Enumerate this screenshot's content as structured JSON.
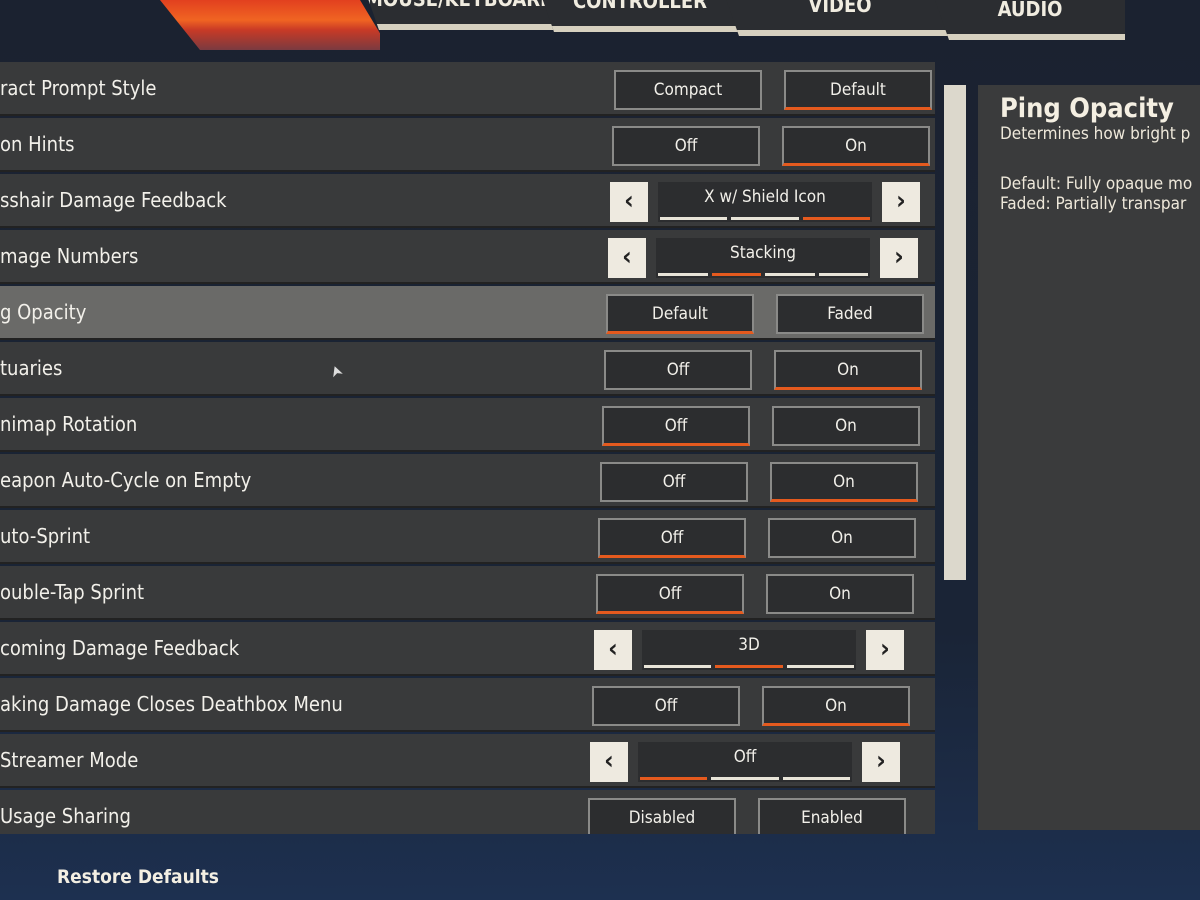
{
  "tabs": [
    {
      "label": "MOUSE/KEYBOARD"
    },
    {
      "label": "CONTROLLER"
    },
    {
      "label": "VIDEO"
    },
    {
      "label": "AUDIO"
    }
  ],
  "rows": [
    {
      "label": "ract Prompt Style",
      "type": "toggle",
      "options": [
        "Compact",
        "Default"
      ],
      "selected": 1
    },
    {
      "label": "on Hints",
      "type": "toggle",
      "options": [
        "Off",
        "On"
      ],
      "selected": 1
    },
    {
      "label": "sshair Damage Feedback",
      "type": "carousel",
      "value": "X w/ Shield Icon",
      "segments": 3,
      "selected": 2
    },
    {
      "label": "mage Numbers",
      "type": "carousel",
      "value": "Stacking",
      "segments": 4,
      "selected": 1
    },
    {
      "label": "g Opacity",
      "type": "toggle",
      "options": [
        "Default",
        "Faded"
      ],
      "selected": 0,
      "highlighted": true
    },
    {
      "label": "tuaries",
      "type": "toggle",
      "options": [
        "Off",
        "On"
      ],
      "selected": 1
    },
    {
      "label": "nimap Rotation",
      "type": "toggle",
      "options": [
        "Off",
        "On"
      ],
      "selected": 0
    },
    {
      "label": "eapon Auto-Cycle on Empty",
      "type": "toggle",
      "options": [
        "Off",
        "On"
      ],
      "selected": 1
    },
    {
      "label": "uto-Sprint",
      "type": "toggle",
      "options": [
        "Off",
        "On"
      ],
      "selected": 0
    },
    {
      "label": "ouble-Tap Sprint",
      "type": "toggle",
      "options": [
        "Off",
        "On"
      ],
      "selected": 0
    },
    {
      "label": "coming Damage Feedback",
      "type": "carousel",
      "value": "3D",
      "segments": 3,
      "selected": 1
    },
    {
      "label": "aking Damage Closes Deathbox Menu",
      "type": "toggle",
      "options": [
        "Off",
        "On"
      ],
      "selected": 1
    },
    {
      "label": "Streamer Mode",
      "type": "carousel",
      "value": "Off",
      "segments": 3,
      "selected": 0
    },
    {
      "label": "Usage Sharing",
      "type": "toggle",
      "options": [
        "Disabled",
        "Enabled"
      ],
      "selected": -1
    }
  ],
  "info": {
    "title": "Ping Opacity",
    "description": "Determines how bright p",
    "line1": "Default: Fully opaque mo",
    "line2": "Faded: Partially transpar"
  },
  "footer": {
    "restore_label": "Restore Defaults"
  },
  "icons": {
    "prev": "‹",
    "next": "›",
    "cursor": "➤"
  },
  "colors": {
    "accent": "#e55a1e",
    "row": "#393a3b",
    "highlight": "#6a6a68"
  }
}
